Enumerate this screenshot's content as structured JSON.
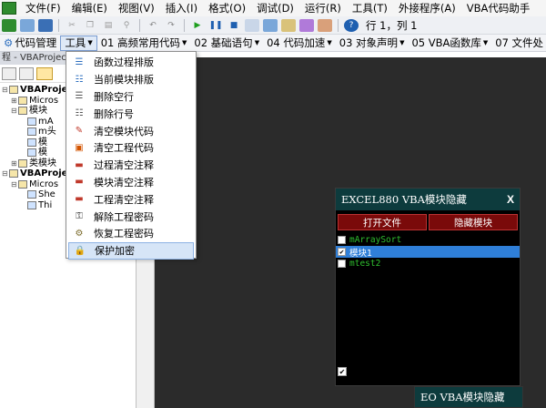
{
  "menubar": {
    "items": [
      "文件(F)",
      "编辑(E)",
      "视图(V)",
      "插入(I)",
      "格式(O)",
      "调试(D)",
      "运行(R)",
      "工具(T)",
      "外接程序(A)",
      "VBA代码助手"
    ]
  },
  "toolbar": {
    "position": "行 1，列 1"
  },
  "toolbar2": {
    "items": [
      "代码管理",
      "工具",
      "01 高频常用代码",
      "02 基础语句",
      "04 代码加速",
      "03 对象声明",
      "05 VBA函数库",
      "07 文件处"
    ]
  },
  "project_pane": {
    "title": "程 - VBAProject",
    "tree": [
      {
        "label": "VBAProje",
        "bold": true,
        "exp": "⊟",
        "indent": 0
      },
      {
        "label": "Micros",
        "bold": false,
        "exp": "⊞",
        "indent": 1
      },
      {
        "label": "模块",
        "bold": false,
        "exp": "⊟",
        "indent": 1
      },
      {
        "label": "mA",
        "bold": false,
        "exp": "",
        "indent": 2
      },
      {
        "label": "m头",
        "bold": false,
        "exp": "",
        "indent": 2
      },
      {
        "label": "模",
        "bold": false,
        "exp": "",
        "indent": 2
      },
      {
        "label": "模",
        "bold": false,
        "exp": "",
        "indent": 2
      },
      {
        "label": "类模块",
        "bold": false,
        "exp": "⊞",
        "indent": 1
      },
      {
        "label": "VBAProje",
        "bold": true,
        "exp": "⊟",
        "indent": 0
      },
      {
        "label": "Micros",
        "bold": false,
        "exp": "⊟",
        "indent": 1
      },
      {
        "label": "She",
        "bold": false,
        "exp": "",
        "indent": 2
      },
      {
        "label": "Thi",
        "bold": false,
        "exp": "",
        "indent": 2
      }
    ]
  },
  "dropdown": {
    "items": [
      {
        "label": "函数过程排版",
        "icon": "format-icon"
      },
      {
        "label": "当前模块排版",
        "icon": "module-format-icon"
      },
      {
        "label": "删除空行",
        "icon": "delete-lines-icon"
      },
      {
        "label": "删除行号",
        "icon": "delete-line-numbers-icon"
      },
      {
        "label": "清空模块代码",
        "icon": "clear-module-icon"
      },
      {
        "label": "清空工程代码",
        "icon": "clear-project-icon"
      },
      {
        "label": "过程清空注释",
        "icon": "clear-proc-comments-icon"
      },
      {
        "label": "模块清空注释",
        "icon": "clear-module-comments-icon"
      },
      {
        "label": "工程清空注释",
        "icon": "clear-project-comments-icon"
      },
      {
        "label": "解除工程密码",
        "icon": "key-icon"
      },
      {
        "label": "恢复工程密码",
        "icon": "restore-password-icon"
      },
      {
        "label": "保护加密",
        "icon": "lock-icon",
        "hover": true
      }
    ]
  },
  "vba_panel": {
    "title": "EXCEL880 VBA模块隐藏",
    "close": "X",
    "open_file": "打开文件",
    "hide_module": "隐藏模块",
    "rows": [
      {
        "label": "mArraySort",
        "checked": false,
        "selected": false
      },
      {
        "label": "模块1",
        "checked": true,
        "selected": true
      },
      {
        "label": "mtest2",
        "checked": false,
        "selected": false
      }
    ]
  },
  "vba_panel2": {
    "title": "EO VBA模块隐藏"
  }
}
